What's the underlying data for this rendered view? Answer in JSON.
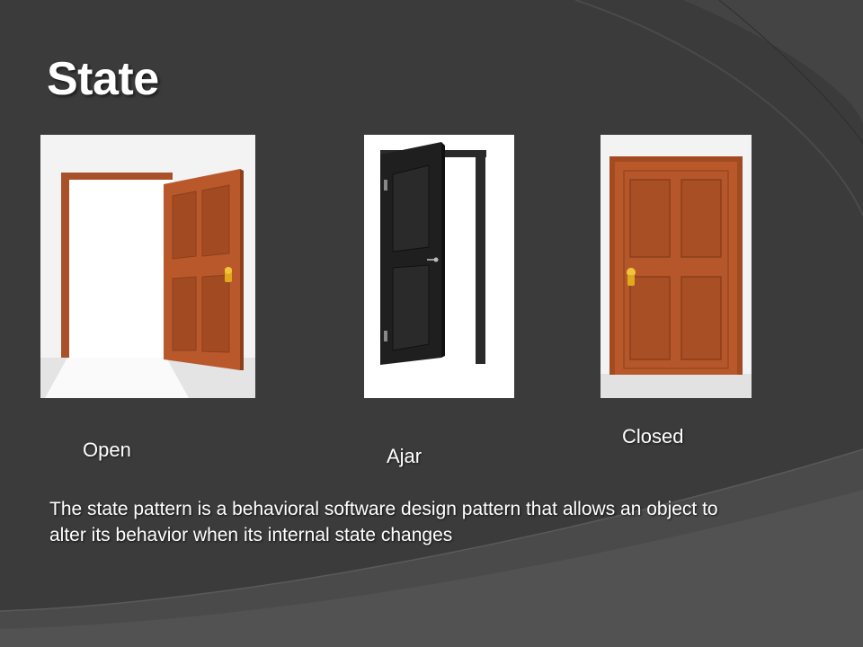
{
  "slide": {
    "title": "State",
    "states": [
      {
        "label": "Open",
        "picture": "open-door"
      },
      {
        "label": "Ajar",
        "picture": "ajar-door"
      },
      {
        "label": "Closed",
        "picture": "closed-door"
      }
    ],
    "description": "The state pattern is a behavioral software design pattern that allows an object to alter its behavior when its internal state changes"
  },
  "colors": {
    "background": "#3a3a3a",
    "text": "#ffffff",
    "door_wood": "#b5582a",
    "door_black": "#1f1f1f",
    "knob_gold": "#e0a81c"
  }
}
